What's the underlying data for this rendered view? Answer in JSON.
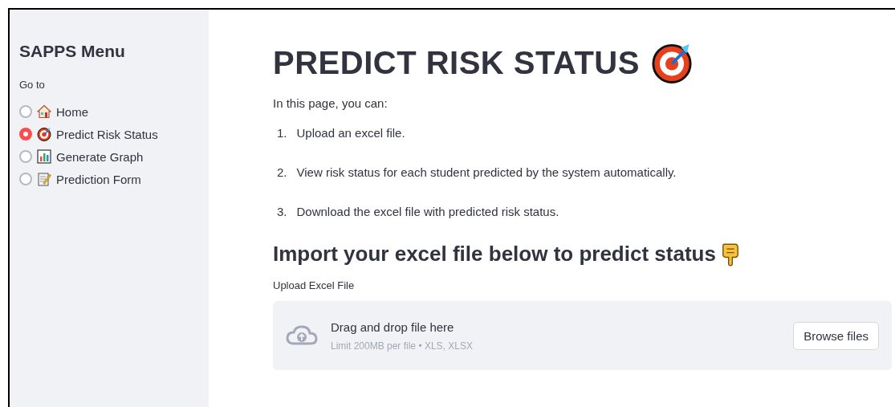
{
  "sidebar": {
    "title": "SAPPS Menu",
    "radio_label": "Go to",
    "items": [
      {
        "label": "Home",
        "selected": false
      },
      {
        "label": "Predict Risk Status",
        "selected": true
      },
      {
        "label": "Generate Graph",
        "selected": false
      },
      {
        "label": "Prediction Form",
        "selected": false
      }
    ]
  },
  "main": {
    "title": "PREDICT RISK STATUS",
    "intro": "In this page, you can:",
    "steps": [
      {
        "number": "1.",
        "text": "Upload an excel file."
      },
      {
        "number": "2.",
        "text": "View risk status for each student predicted by the system automatically."
      },
      {
        "number": "3.",
        "text": "Download the excel file with predicted risk status."
      }
    ],
    "subheading": "Import your excel file below to predict status",
    "uploader": {
      "label": "Upload Excel File",
      "instruction": "Drag and drop file here",
      "limits": "Limit 200MB per file • XLS, XLSX",
      "button": "Browse files"
    }
  }
}
